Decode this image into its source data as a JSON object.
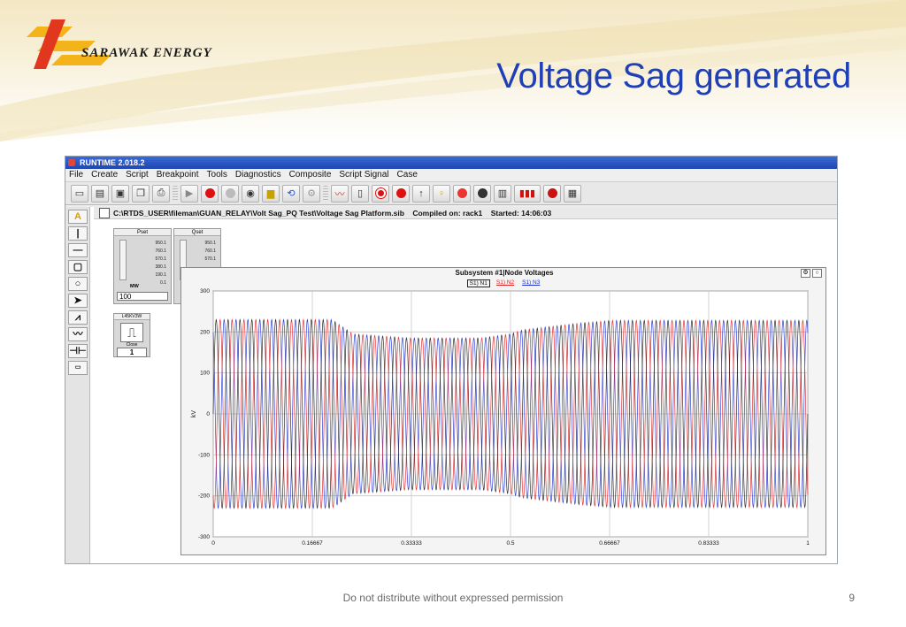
{
  "slide": {
    "title": "Voltage Sag generated",
    "logo_text": "SARAWAK ENERGY",
    "footer": "Do not distribute without expressed permission",
    "page_number": "9",
    "accent_color": "#1f3fb6"
  },
  "app": {
    "title": "RUNTIME 2.018.2",
    "menu": [
      "File",
      "Create",
      "Script",
      "Breakpoint",
      "Tools",
      "Diagnostics",
      "Composite",
      "Script Signal",
      "Case"
    ],
    "path_bar": "C:\\RTDS_USER\\fileman\\GUAN_RELAY\\Volt Sag_PQ Test\\Voltage Sag Platform.sib",
    "compiled_on": "Compiled on: rack1",
    "started": "Started: 14:06:03",
    "toolbar_icons": [
      "new-icon",
      "open-icon",
      "save-icon",
      "copy-icon",
      "print-icon",
      "play-icon",
      "stop-icon",
      "record-icon",
      "camera-icon",
      "folder-icon",
      "refresh-icon",
      "settings-icon",
      "plot-icon",
      "meter-icon",
      "pause-icon",
      "stop2-icon",
      "arrow-icon",
      "bulb-icon",
      "alarm-icon",
      "disk-icon",
      "clipboard-icon",
      "bars-icon",
      "record2-icon",
      "grid-icon"
    ],
    "palette_icons": [
      "text-tool-icon",
      "vertical-line-icon",
      "horizontal-line-icon",
      "rectangle-icon",
      "circle-icon",
      "arrow-right-icon",
      "resistor-icon",
      "inductor-icon",
      "capacitor-icon",
      "label-icon"
    ]
  },
  "sliders": [
    {
      "label": "Pset",
      "ticks": [
        "950.1",
        "760.1",
        "570.1",
        "380.1",
        "190.1",
        "0.1"
      ],
      "unit": "MW",
      "value": "100"
    },
    {
      "label": "Qset",
      "ticks": [
        "950.1",
        "760.1",
        "570.1"
      ],
      "unit": "",
      "value": ""
    }
  ],
  "switch": {
    "label": "L45KV3W",
    "caption": "Close",
    "value": "1"
  },
  "plot": {
    "window_title": "Subsystem #1|Node Voltages",
    "legend": [
      "S1) N1",
      "S1) N2",
      "S1) N3"
    ]
  },
  "chart_data": {
    "type": "line",
    "title": "Subsystem #1|Node Voltages",
    "xlabel": "",
    "ylabel": "kV",
    "xlim": [
      0,
      1
    ],
    "ylim": [
      -300,
      300
    ],
    "x_ticks": [
      "0",
      "0.16667",
      "0.33333",
      "0.5",
      "0.66667",
      "0.83333",
      "1"
    ],
    "y_ticks": [
      "300",
      "200",
      "100",
      "0",
      "-100",
      "-200",
      "-300"
    ],
    "frequency_hz": 50,
    "envelope": {
      "t": [
        0,
        0.2,
        0.235,
        0.33,
        0.45,
        0.5,
        0.52,
        0.62,
        0.67,
        0.8,
        1.0
      ],
      "amplitude": [
        230,
        230,
        195,
        185,
        185,
        195,
        205,
        222,
        228,
        228,
        228
      ]
    },
    "series": [
      {
        "name": "S1) N1",
        "color": "#1a1a1a",
        "phase_deg": 0
      },
      {
        "name": "S1) N2",
        "color": "#e02020",
        "phase_deg": -120
      },
      {
        "name": "S1) N3",
        "color": "#1a2fd0",
        "phase_deg": 120
      }
    ],
    "grid": true,
    "legend_position": "top-center"
  }
}
